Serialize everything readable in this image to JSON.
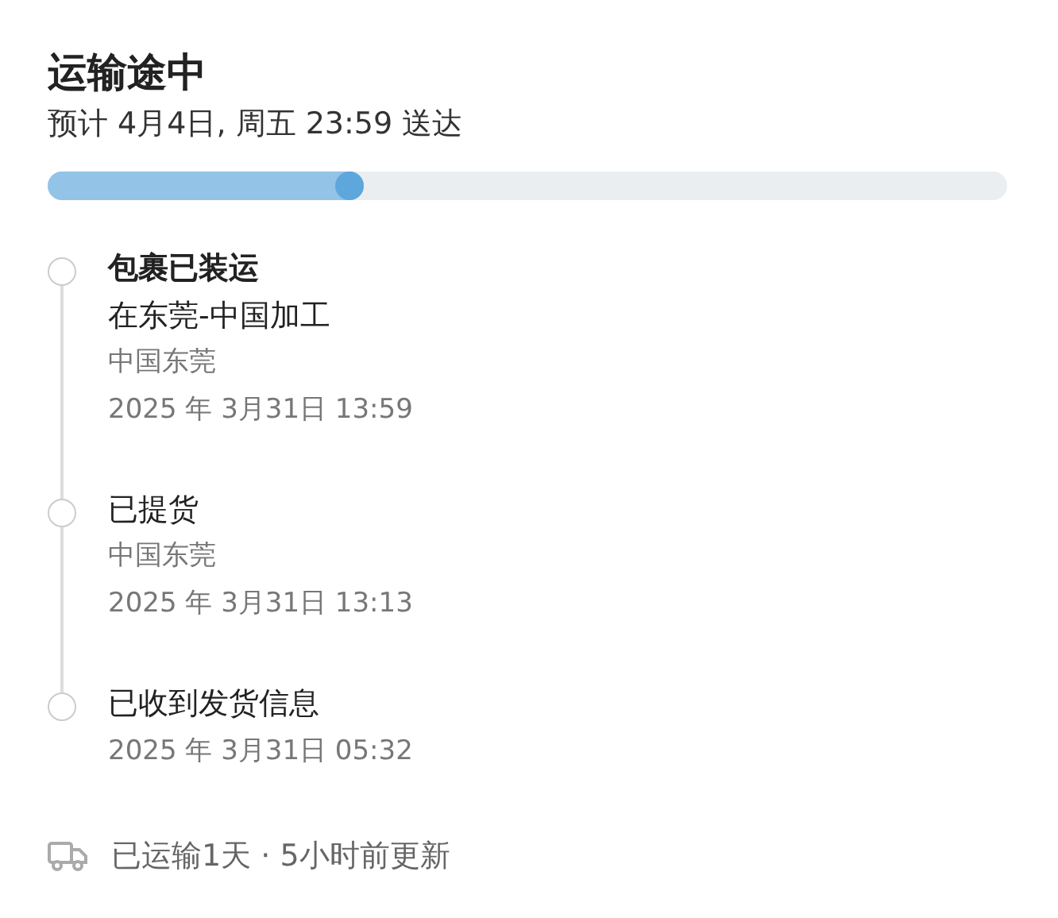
{
  "status": {
    "title": "运输途中",
    "estimate": "预计 4月4日, 周五 23:59 送达",
    "level": 0.33
  },
  "events": [
    {
      "title": "包裹已装运",
      "current": true,
      "detail": "在东莞-中国加工",
      "location": "中国东莞",
      "time": "2025 年 3月31日  13:59"
    },
    {
      "title": "已提货",
      "current": false,
      "location": "中国东莞",
      "time": "2025 年 3月31日  13:13"
    },
    {
      "title": "已收到发货信息",
      "current": false,
      "time": "2025 年 3月31日  05:32"
    }
  ],
  "footer": {
    "text": "已运输1天 · 5小时前更新"
  }
}
